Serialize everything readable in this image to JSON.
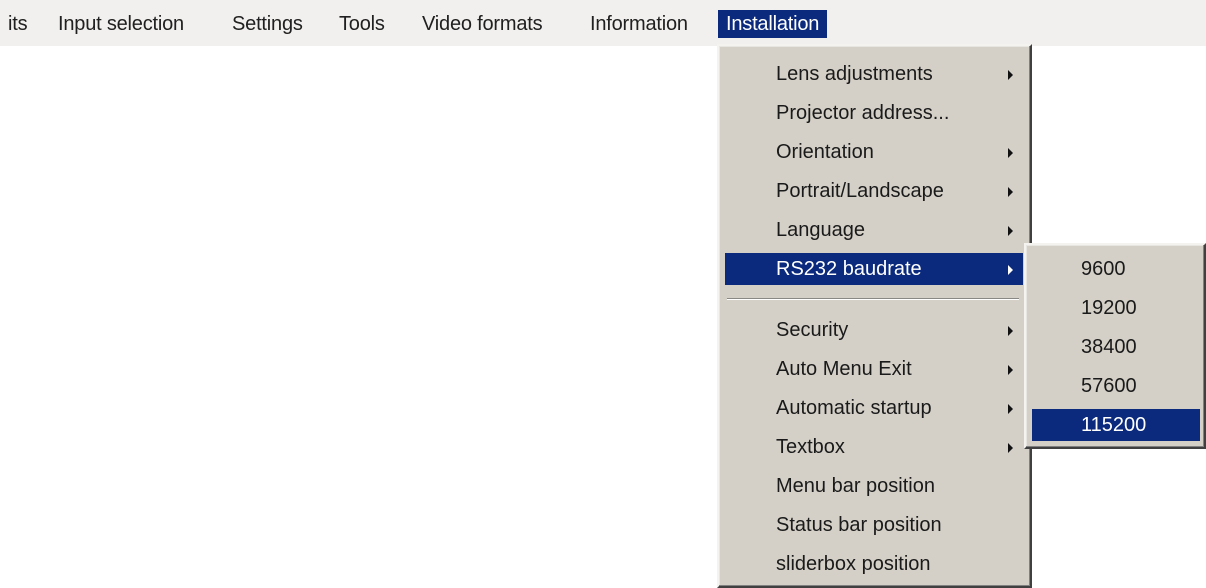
{
  "menubar": {
    "items": [
      {
        "label": "its"
      },
      {
        "label": "Input selection"
      },
      {
        "label": "Settings"
      },
      {
        "label": "Tools"
      },
      {
        "label": "Video formats"
      },
      {
        "label": "Information"
      },
      {
        "label": "Installation",
        "active": true
      }
    ]
  },
  "installation_menu": {
    "items": [
      {
        "label": "Lens adjustments",
        "submenu": true
      },
      {
        "label": "Projector address...",
        "submenu": false
      },
      {
        "label": "Orientation",
        "submenu": true
      },
      {
        "label": "Portrait/Landscape",
        "submenu": true
      },
      {
        "label": "Language",
        "submenu": true
      },
      {
        "label": "RS232 baudrate",
        "submenu": true,
        "selected": true
      },
      {
        "label": "Security",
        "submenu": true
      },
      {
        "label": "Auto Menu Exit",
        "submenu": true
      },
      {
        "label": "Automatic startup",
        "submenu": true
      },
      {
        "label": "Textbox",
        "submenu": true
      },
      {
        "label": "Menu bar position",
        "submenu": false
      },
      {
        "label": "Status bar position",
        "submenu": false
      },
      {
        "label": "sliderbox position",
        "submenu": false
      }
    ]
  },
  "baudrate_submenu": {
    "items": [
      {
        "label": "9600"
      },
      {
        "label": "19200"
      },
      {
        "label": "38400"
      },
      {
        "label": "57600"
      },
      {
        "label": "115200",
        "selected": true
      }
    ]
  },
  "colors": {
    "highlight": "#0b2a7d",
    "menu_face": "#d4d0c8",
    "menubar_bg": "#f2f0ee"
  }
}
